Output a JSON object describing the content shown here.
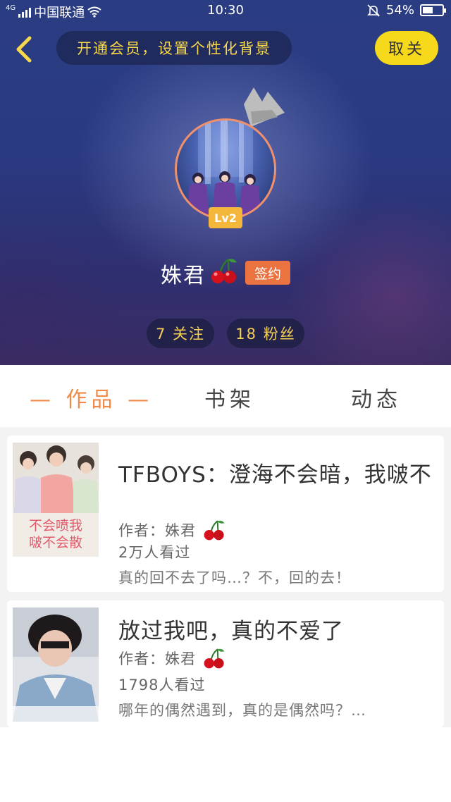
{
  "status_bar": {
    "network_type": "4G",
    "carrier": "中国联通",
    "time": "10:30",
    "battery_percent": "54%",
    "battery_level": 0.54
  },
  "header": {
    "back_icon": "chevron-left-icon",
    "vip_banner": "开通会员，设置个性化背景",
    "unfollow_label": "取关"
  },
  "profile": {
    "level": "Lv2",
    "name": "姝君",
    "signed_badge": "签约",
    "following": "7 关注",
    "followers": "18 粉丝"
  },
  "tabs": [
    {
      "label": "— 作品 —",
      "active": true
    },
    {
      "label": "书架",
      "active": false
    },
    {
      "label": "动态",
      "active": false
    }
  ],
  "works": [
    {
      "title": "TFBOYS：澄海不会暗，我啵不",
      "author": "作者：姝君",
      "views": "2万人看过",
      "desc": "真的回不去了吗…？不，回的去！",
      "cover_text": "不会喷我 啵不会散"
    },
    {
      "title": "放过我吧，真的不爱了",
      "author": "作者：姝君",
      "views": "1798人看过",
      "desc": "哪年的偶然遇到，真的是偶然吗？…"
    }
  ],
  "colors": {
    "accent_orange": "#ef8a4b",
    "vip_yellow": "#f7d84a",
    "unfollow_bg": "#f7d91c",
    "signed_bg": "#ea7340",
    "level_bg": "#f4b73b"
  }
}
